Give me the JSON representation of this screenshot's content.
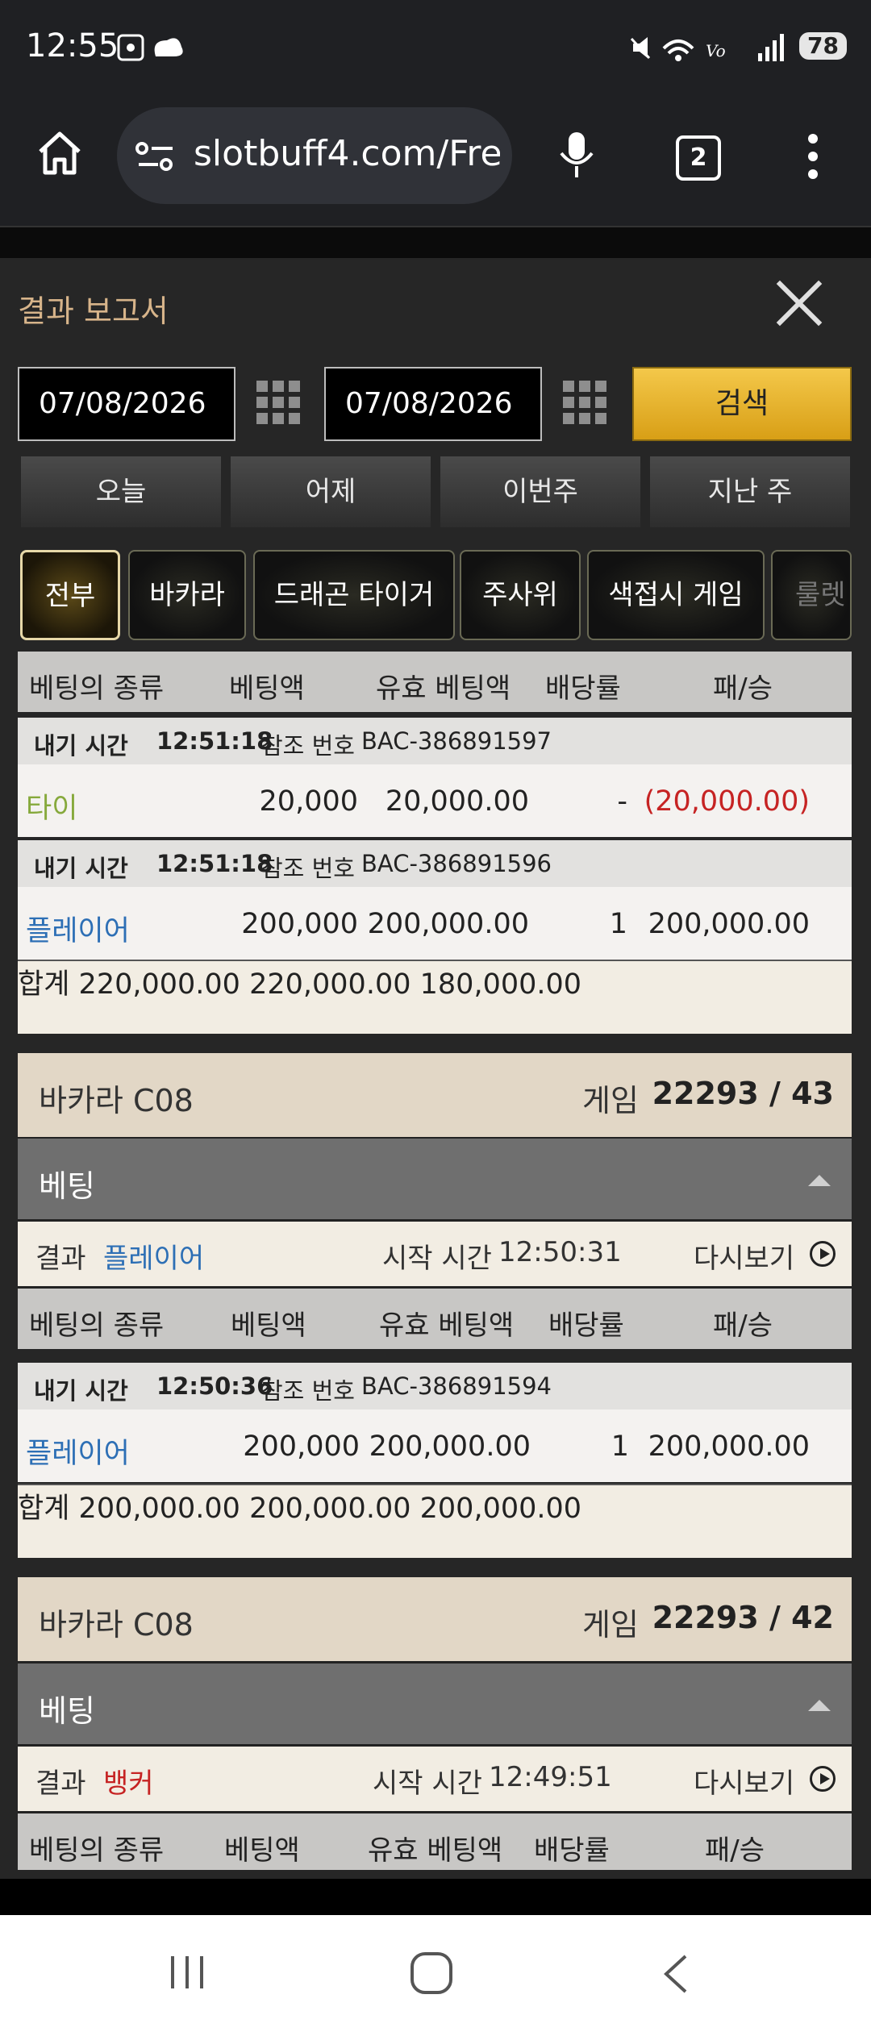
{
  "status_bar": {
    "time": "12:55",
    "battery": "78"
  },
  "browser": {
    "url": "slotbuff4.com/Fre",
    "tab_count": "2"
  },
  "modal": {
    "title": "결과 보고서",
    "date_from": "07/08/2026",
    "date_to": "07/08/2026",
    "search_label": "검색",
    "quick_ranges": [
      "오늘",
      "어제",
      "이번주",
      "지난 주"
    ],
    "categories": [
      "전부",
      "바카라",
      "드래곤 타이거",
      "주사위",
      "색접시 게임",
      "룰렛"
    ],
    "active_category": "전부"
  },
  "columns": [
    "베팅의 종류",
    "베팅액",
    "유효 베팅액",
    "배당률",
    "패/승"
  ],
  "labels": {
    "total": "합계",
    "game_prefix": "게임",
    "betting": "베팅",
    "result": "결과",
    "start_time": "시작 시간",
    "replay": "다시보기",
    "place_time": "내기 시간",
    "reference": "참조 번호"
  },
  "group0": {
    "bets": [
      {
        "time": "12:51:18",
        "ref": "BAC-386891597",
        "type": "타이",
        "type_color": "green",
        "amount": "20,000",
        "valid": "20,000.00",
        "odds": "-",
        "result": "(20,000.00)",
        "result_color": "red"
      },
      {
        "time": "12:51:18",
        "ref": "BAC-386891596",
        "type": "플레이어",
        "type_color": "blue",
        "amount": "200,000",
        "valid": "200,000.00",
        "odds": "1",
        "result": "200,000.00",
        "result_color": ""
      }
    ],
    "total": {
      "amount": "220,000.00",
      "valid": "220,000.00",
      "result": "180,000.00"
    }
  },
  "group1": {
    "table": "바카라 C08",
    "game_no": "22293 / 43",
    "result": "플레이어",
    "result_color": "blue",
    "start": "12:50:31",
    "bets": [
      {
        "time": "12:50:36",
        "ref": "BAC-386891594",
        "type": "플레이어",
        "type_color": "blue",
        "amount": "200,000",
        "valid": "200,000.00",
        "odds": "1",
        "result": "200,000.00",
        "result_color": ""
      }
    ],
    "total": {
      "amount": "200,000.00",
      "valid": "200,000.00",
      "result": "200,000.00"
    }
  },
  "group2": {
    "table": "바카라 C08",
    "game_no": "22293 / 42",
    "result": "뱅커",
    "result_color": "red",
    "start": "12:49:51"
  },
  "colors": {
    "accent_gold": "#f0c040",
    "player_blue": "#2d6fb5",
    "banker_red": "#c62323",
    "tie_green": "#86a93c"
  }
}
